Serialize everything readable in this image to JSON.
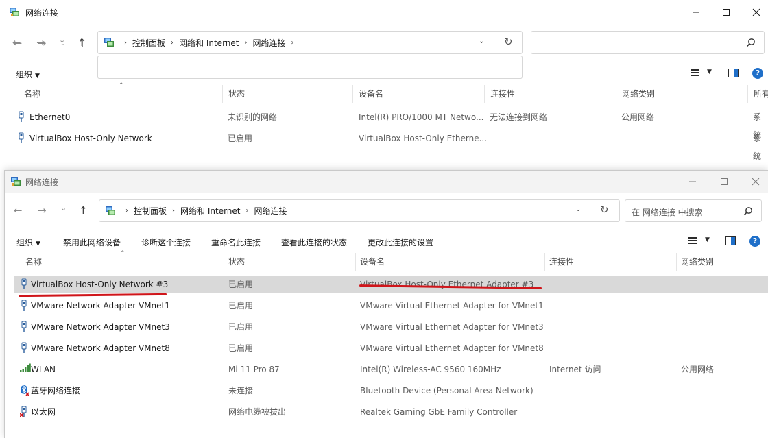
{
  "win1": {
    "title": "网络连接",
    "breadcrumb": [
      "控制面板",
      "网络和 Internet",
      "网络连接"
    ],
    "search_placeholder": "",
    "toolbar": {
      "organize": "组织"
    },
    "columns": [
      "名称",
      "状态",
      "设备名",
      "连接性",
      "网络类别",
      "所有"
    ],
    "rows": [
      {
        "name": "Ethernet0",
        "status": "未识别的网络",
        "device": "Intel(R) PRO/1000 MT Netwo...",
        "connectivity": "无法连接到网络",
        "category": "公用网络",
        "owner": "系统"
      },
      {
        "name": "VirtualBox Host-Only Network",
        "status": "已启用",
        "device": "VirtualBox Host-Only Etherne...",
        "connectivity": "",
        "category": "",
        "owner": "系统"
      }
    ]
  },
  "win2": {
    "title": "网络连接",
    "breadcrumb": [
      "控制面板",
      "网络和 Internet",
      "网络连接"
    ],
    "search_placeholder": "在 网络连接 中搜索",
    "toolbar": {
      "organize": "组织",
      "disable": "禁用此网络设备",
      "diagnose": "诊断这个连接",
      "rename": "重命名此连接",
      "view_status": "查看此连接的状态",
      "change_settings": "更改此连接的设置"
    },
    "columns": [
      "名称",
      "状态",
      "设备名",
      "连接性",
      "网络类别"
    ],
    "rows": [
      {
        "name": "VirtualBox Host-Only Network #3",
        "status": "已启用",
        "device": "VirtualBox Host-Only Ethernet Adapter #3",
        "connectivity": "",
        "category": "",
        "icon": "ethernet-icon",
        "selected": true
      },
      {
        "name": "VMware Network Adapter VMnet1",
        "status": "已启用",
        "device": "VMware Virtual Ethernet Adapter for VMnet1",
        "connectivity": "",
        "category": "",
        "icon": "ethernet-icon"
      },
      {
        "name": "VMware Network Adapter VMnet3",
        "status": "已启用",
        "device": "VMware Virtual Ethernet Adapter for VMnet3",
        "connectivity": "",
        "category": "",
        "icon": "ethernet-icon"
      },
      {
        "name": "VMware Network Adapter VMnet8",
        "status": "已启用",
        "device": "VMware Virtual Ethernet Adapter for VMnet8",
        "connectivity": "",
        "category": "",
        "icon": "ethernet-icon"
      },
      {
        "name": "WLAN",
        "status": "Mi 11 Pro 87",
        "device": "Intel(R) Wireless-AC 9560 160MHz",
        "connectivity": "Internet 访问",
        "category": "公用网络",
        "icon": "wifi-signal-icon"
      },
      {
        "name": "蓝牙网络连接",
        "status": "未连接",
        "device": "Bluetooth Device (Personal Area Network)",
        "connectivity": "",
        "category": "",
        "icon": "bluetooth-icon"
      },
      {
        "name": "以太网",
        "status": "网络电缆被拔出",
        "device": "Realtek Gaming GbE Family Controller",
        "connectivity": "",
        "category": "",
        "icon": "ethernet-disconnected-icon"
      }
    ]
  },
  "colors": {
    "accent": "#1f6fc9",
    "selection": "#d9d9d9",
    "annotation": "#d0161b"
  }
}
